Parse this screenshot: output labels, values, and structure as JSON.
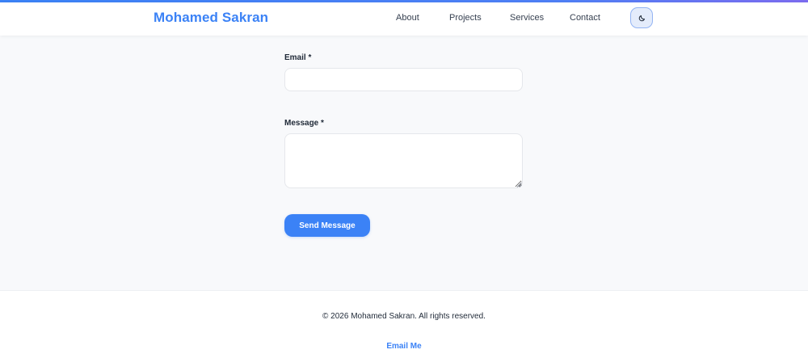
{
  "header": {
    "brand": "Mohamed Sakran",
    "nav": [
      {
        "label": "About"
      },
      {
        "label": "Projects"
      },
      {
        "label": "Services"
      },
      {
        "label": "Contact"
      }
    ],
    "theme_toggle_icon": "moon-icon"
  },
  "form": {
    "email": {
      "label": "Email *",
      "value": "",
      "placeholder": ""
    },
    "message": {
      "label": "Message *",
      "value": "",
      "placeholder": ""
    },
    "submit_label": "Send Message"
  },
  "footer": {
    "copyright": "© 2026 Mohamed Sakran. All rights reserved.",
    "email_link": "Email Me"
  },
  "colors": {
    "accent": "#3b82f6",
    "page_background": "#f8f9fb",
    "text": "#1f2937"
  }
}
